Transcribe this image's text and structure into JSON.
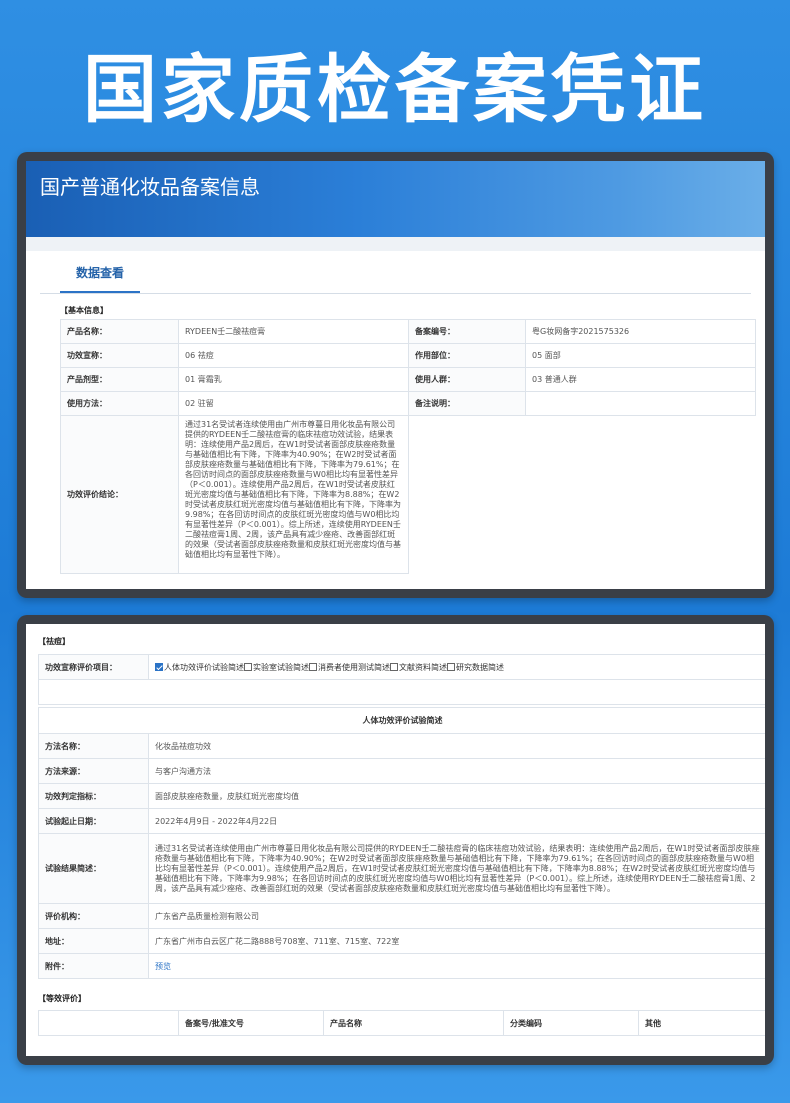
{
  "headline": "国家质检备案凭证",
  "banner_title": "国产普通化妆品备案信息",
  "tab": "数据查看",
  "basic_section": "【基本信息】",
  "basic": [
    {
      "l1": "产品名称：",
      "v1": "RYDEEN壬二酸祛痘膏",
      "l2": "备案编号：",
      "v2": "粤G妆网备字2021575326"
    },
    {
      "l1": "功效宣称：",
      "v1": "06 祛痘",
      "l2": "作用部位：",
      "v2": "05 面部"
    },
    {
      "l1": "产品剂型：",
      "v1": "01 膏霜乳",
      "l2": "使用人群：",
      "v2": "03 普通人群"
    },
    {
      "l1": "使用方法：",
      "v1": "02 驻留",
      "l2": "备注说明：",
      "v2": ""
    }
  ],
  "eval_label": "功效评价结论：",
  "eval_text": "通过31名受试者连续使用由广州市尊蔓日用化妆品有限公司提供的RYDEEN壬二酸祛痘膏的临床祛痘功效试验，结果表明：连续使用产品2周后，在W1时受试者面部皮肤痤疮数量与基础值相比有下降，下降率为40.90%；在W2时受试者面部皮肤痤疮数量与基础值相比有下降，下降率为79.61%；在各回访时间点的面部皮肤痤疮数量与W0相比均有显著性差异（P＜0.001）。连续使用产品2周后，在W1时受试者皮肤红斑光密度均值与基础值相比有下降，下降率为8.88%；在W2时受试者皮肤红斑光密度均值与基础值相比有下降，下降率为9.98%；在各回访时间点的皮肤红斑光密度均值与W0相比均有显著性差异（P＜0.001）。综上所述，连续使用RYDEEN壬二酸祛痘膏1周、2周，该产品具有减少痤疮、改善面部红斑的效果（受试者面部皮肤痤疮数量和皮肤红斑光密度均值与基础值相比均有显著性下降）。",
  "claim_section": "【祛痘】",
  "claim_label": "功效宣称评价项目：",
  "claim_items": [
    {
      "text": "人体功效评价试验简述",
      "checked": true
    },
    {
      "text": "实验室试验简述",
      "checked": false
    },
    {
      "text": "消费者使用测试简述",
      "checked": false
    },
    {
      "text": "文献资料简述",
      "checked": false
    },
    {
      "text": "研究数据简述",
      "checked": false
    }
  ],
  "study_head": "人体功效评价试验简述",
  "study": {
    "method_name_label": "方法名称：",
    "method_name": "化妆品祛痘功效",
    "method_source_label": "方法来源：",
    "method_source": "与客户沟通方法",
    "indicator_label": "功效判定指标：",
    "indicator": "面部皮肤痤疮数量，皮肤红斑光密度均值",
    "date_label": "试验起止日期：",
    "date": "2022年4月9日 - 2022年4月22日",
    "result_label": "试验结果简述：",
    "result": "通过31名受试者连续使用由广州市尊蔓日用化妆品有限公司提供的RYDEEN壬二酸祛痘膏的临床祛痘功效试验，结果表明：连续使用产品2周后，在W1时受试者面部皮肤痤疮数量与基础值相比有下降，下降率为40.90%；在W2时受试者面部皮肤痤疮数量与基础值相比有下降，下降率为79.61%；在各回访时间点的面部皮肤痤疮数量与W0相比均有显著性差异（P＜0.001）。连续使用产品2周后，在W1时受试者皮肤红斑光密度均值与基础值相比有下降，下降率为8.88%；在W2时受试者皮肤红斑光密度均值与基础值相比有下降，下降率为9.98%；在各回访时间点的皮肤红斑光密度均值与W0相比均有显著性差异（P＜0.001）。综上所述，连续使用RYDEEN壬二酸祛痘膏1周、2周，该产品具有减少痤疮、改善面部红斑的效果（受试者面部皮肤痤疮数量和皮肤红斑光密度均值与基础值相比均有显著性下降）。",
    "org_label": "评价机构：",
    "org": "广东省产品质量检测有限公司",
    "addr_label": "地址：",
    "addr": "广东省广州市白云区广花二路888号708室、711室、715室、722室",
    "attach_label": "附件：",
    "attach": "预览"
  },
  "equiv_section": "【等效评价】",
  "equiv_headers": [
    "备案号/批准文号",
    "产品名称",
    "分类编码",
    "其他"
  ],
  "colors": {
    "accent": "#2b73c6",
    "banner": "#1a5fb4",
    "frame": "#3a3f47"
  }
}
